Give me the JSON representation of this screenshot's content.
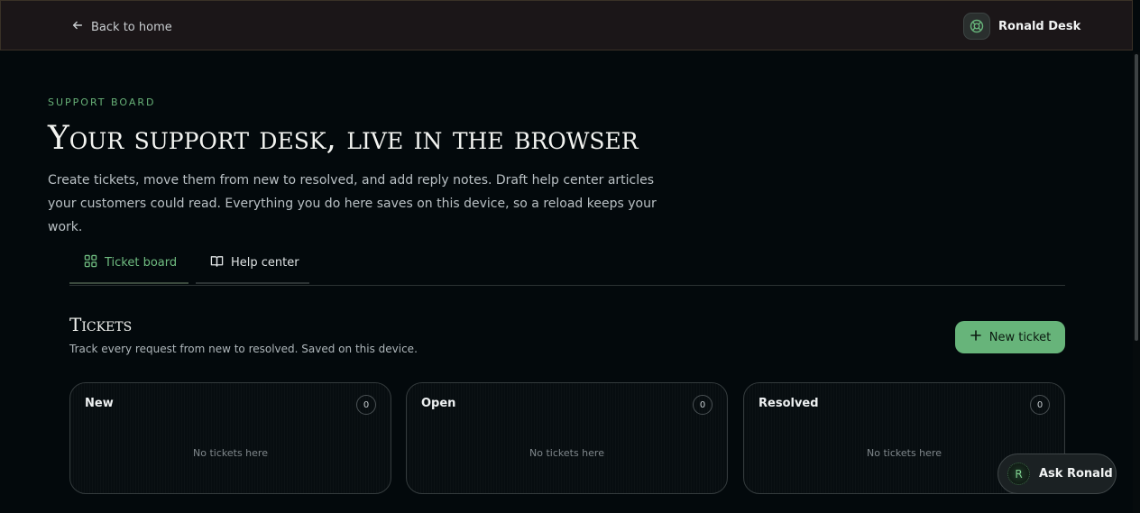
{
  "topbar": {
    "back_label": "Back to home",
    "account_name": "Ronald Desk",
    "account_icon": "lifebuoy-icon"
  },
  "hero": {
    "eyebrow": "SUPPORT BOARD",
    "title": "Your support desk, live in the browser",
    "description": "Create tickets, move them from new to resolved, and add reply notes. Draft help center articles your customers could read. Everything you do here saves on this device, so a reload keeps your work."
  },
  "tabs": [
    {
      "label": "Ticket board",
      "icon": "grid-icon",
      "active": true
    },
    {
      "label": "Help center",
      "icon": "book-icon",
      "active": false
    }
  ],
  "tickets": {
    "title": "Tickets",
    "subtitle": "Track every request from new to resolved. Saved on this device.",
    "new_button": "New ticket",
    "columns": [
      {
        "title": "New",
        "count": "0",
        "empty": "No tickets here"
      },
      {
        "title": "Open",
        "count": "0",
        "empty": "No tickets here"
      },
      {
        "title": "Resolved",
        "count": "0",
        "empty": "No tickets here"
      }
    ]
  },
  "assistant": {
    "avatar_letter": "R",
    "label": "Ask Ronald"
  },
  "colors": {
    "background": "#03090c",
    "topbar": "#1b1618",
    "accent": "#67b47a"
  }
}
